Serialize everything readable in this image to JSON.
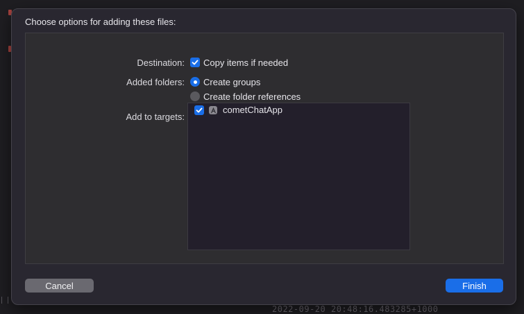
{
  "dialog": {
    "title": "Choose options for adding these files:",
    "destination_label": "Destination:",
    "destination_option": "Copy items if needed",
    "added_folders_label": "Added folders:",
    "folder_options": [
      "Create groups",
      "Create folder references"
    ],
    "selected_folder_option": "Create groups",
    "targets_label": "Add to targets:",
    "targets": [
      {
        "name": "cometChatApp",
        "checked": true
      }
    ],
    "cancel_label": "Cancel",
    "finish_label": "Finish"
  },
  "background": {
    "status_text": "2022-09-20 20:48:16.483285+1000"
  },
  "colors": {
    "accent": "#1a6ee8",
    "sheet": "#292730",
    "panel": "#2e2d30"
  }
}
